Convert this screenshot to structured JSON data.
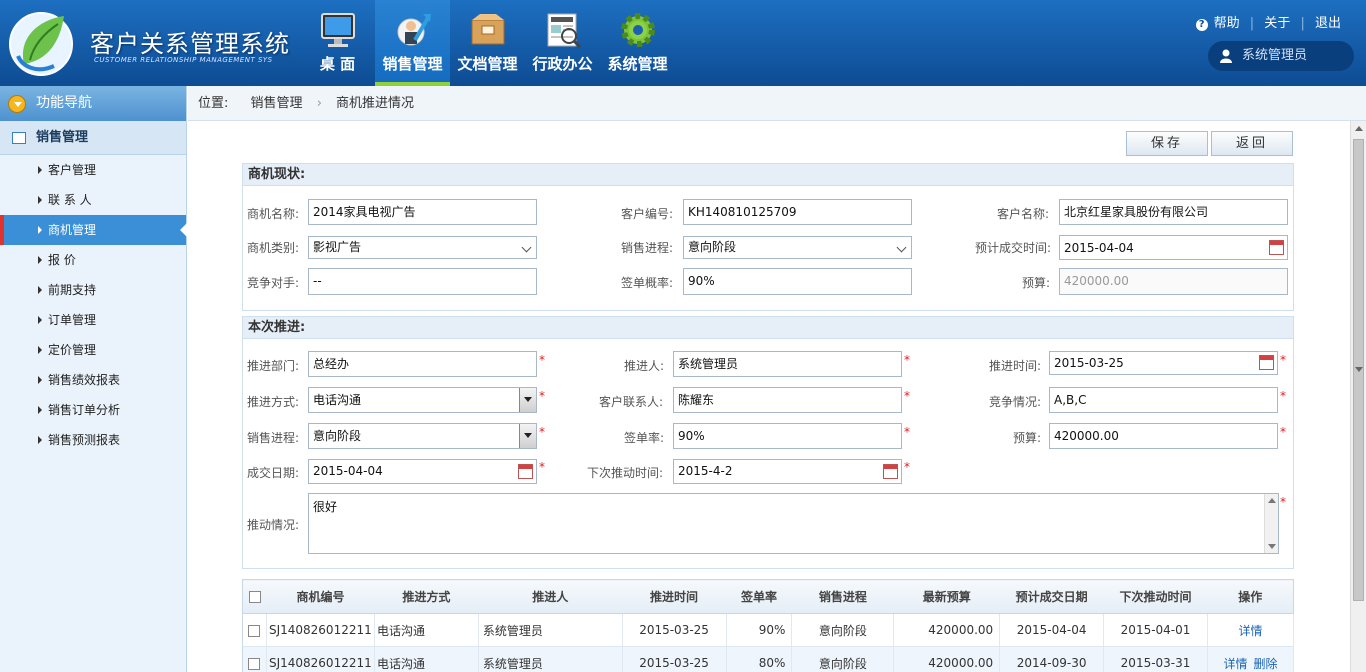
{
  "app": {
    "title": "客户关系管理系统",
    "subtitle": "CUSTOMER RELATIONSHIP MANAGEMENT SYS"
  },
  "nav": [
    {
      "label": "桌 面",
      "icon": "monitor-icon"
    },
    {
      "label": "销售管理",
      "icon": "sales-chart-icon",
      "active": true
    },
    {
      "label": "文档管理",
      "icon": "document-box-icon"
    },
    {
      "label": "行政办公",
      "icon": "news-icon"
    },
    {
      "label": "系统管理",
      "icon": "gear-icon"
    }
  ],
  "top_links": {
    "help": "帮助",
    "about": "关于",
    "logout": "退出"
  },
  "user": {
    "name": "系统管理员"
  },
  "sidebar": {
    "header": "功能导航",
    "section": "销售管理",
    "items": [
      {
        "label": "客户管理"
      },
      {
        "label": "联 系 人"
      },
      {
        "label": "商机管理",
        "active": true
      },
      {
        "label": "报  价"
      },
      {
        "label": "前期支持"
      },
      {
        "label": "订单管理"
      },
      {
        "label": "定价管理"
      },
      {
        "label": "销售绩效报表"
      },
      {
        "label": "销售订单分析"
      },
      {
        "label": "销售预测报表"
      }
    ]
  },
  "breadcrumb": {
    "prefix": "位置:",
    "level1": "销售管理",
    "level2": "商机推进情况"
  },
  "buttons": {
    "save": "保存",
    "back": "返回"
  },
  "status_panel": {
    "title": "商机现状:",
    "opp_name_label": "商机名称:",
    "opp_name": "2014家具电视广告",
    "cust_no_label": "客户编号:",
    "cust_no": "KH140810125709",
    "cust_name_label": "客户名称:",
    "cust_name": "北京红星家具股份有限公司",
    "category_label": "商机类别:",
    "category": "影视广告",
    "progress_label": "销售进程:",
    "progress": "意向阶段",
    "deal_time_label": "预计成交时间:",
    "deal_time": "2015-04-04",
    "rival_label": "竞争对手:",
    "rival": "--",
    "rate_label": "签单概率:",
    "rate": "90%",
    "budget_label": "预算:",
    "budget": "420000.00"
  },
  "advance_panel": {
    "title": "本次推进:",
    "dept_label": "推进部门:",
    "dept": "总经办",
    "person_label": "推进人:",
    "person": "系统管理员",
    "time_label": "推进时间:",
    "time": "2015-03-25",
    "method_label": "推进方式:",
    "method": "电话沟通",
    "contact_label": "客户联系人:",
    "contact": "陈耀东",
    "compete_label": "竞争情况:",
    "compete": "A,B,C",
    "progress_label": "销售进程:",
    "progress": "意向阶段",
    "rate_label": "签单率:",
    "rate": "90%",
    "budget_label": "预算:",
    "budget": "420000.00",
    "deal_date_label": "成交日期:",
    "deal_date": "2015-04-04",
    "next_time_label": "下次推动时间:",
    "next_time": "2015-4-2",
    "situation_label": "推动情况:",
    "situation": "很好",
    "required_mark": "*"
  },
  "table": {
    "headers": [
      "商机编号",
      "推进方式",
      "推进人",
      "推进时间",
      "签单率",
      "销售进程",
      "最新预算",
      "预计成交日期",
      "下次推动时间",
      "操作"
    ],
    "rows": [
      {
        "id": "SJ140826012211",
        "method": "电话沟通",
        "person": "系统管理员",
        "time": "2015-03-25",
        "rate": "90%",
        "progress": "意向阶段",
        "budget": "420000.00",
        "deal": "2015-04-04",
        "next": "2015-04-01",
        "ops": [
          "详情"
        ]
      },
      {
        "id": "SJ140826012211",
        "method": "电话沟通",
        "person": "系统管理员",
        "time": "2015-03-25",
        "rate": "80%",
        "progress": "意向阶段",
        "budget": "420000.00",
        "deal": "2014-09-30",
        "next": "2015-03-31",
        "ops": [
          "详情",
          "删除"
        ]
      }
    ]
  }
}
